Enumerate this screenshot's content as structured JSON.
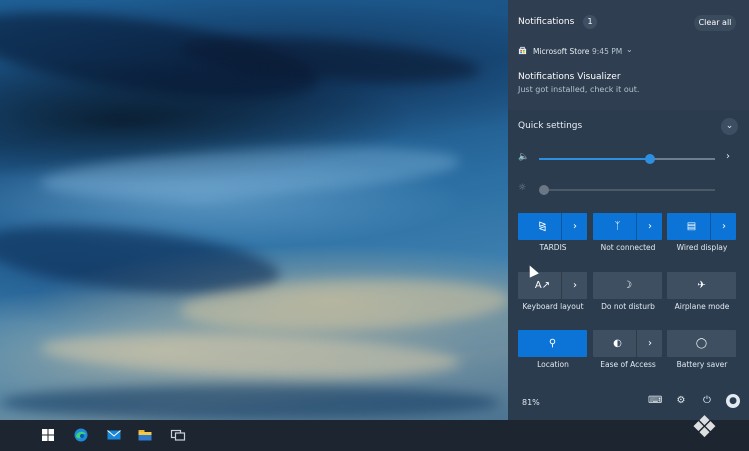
{
  "notifications": {
    "header": "Notifications",
    "count": "1",
    "clear_all": "Clear all",
    "app_name": "Microsoft Store",
    "time": "9:45 PM",
    "title": "Notifications Visualizer",
    "body": "Just got installed, check it out."
  },
  "quick_settings": {
    "title": "Quick settings",
    "volume_level": 0.63,
    "brightness_level": 0.0,
    "tiles": [
      {
        "label": "TARDIS",
        "icon": "wifi-icon",
        "active": true,
        "split": true
      },
      {
        "label": "Not connected",
        "icon": "bluetooth-icon",
        "active": true,
        "split": true
      },
      {
        "label": "Wired display",
        "icon": "project-display-icon",
        "active": true,
        "split": true
      },
      {
        "label": "Keyboard layout",
        "icon": "keyboard-layout-icon",
        "active": false,
        "split": true
      },
      {
        "label": "Do not disturb",
        "icon": "moon-icon",
        "active": false,
        "split": false
      },
      {
        "label": "Airplane mode",
        "icon": "airplane-icon",
        "active": false,
        "split": false
      },
      {
        "label": "Location",
        "icon": "location-icon",
        "active": true,
        "split": false
      },
      {
        "label": "Ease of Access",
        "icon": "ease-of-access-icon",
        "active": false,
        "split": true
      },
      {
        "label": "Battery saver",
        "icon": "battery-saver-icon",
        "active": false,
        "split": false
      }
    ],
    "battery": "81%"
  },
  "taskbar": {
    "icons": [
      "windows-start-icon",
      "edge-icon",
      "mail-icon",
      "file-explorer-icon",
      "task-view-icon"
    ]
  },
  "colors": {
    "accent": "#0b74d6",
    "panel": "#2b3c4f",
    "tile_off": "#3e4f62"
  }
}
